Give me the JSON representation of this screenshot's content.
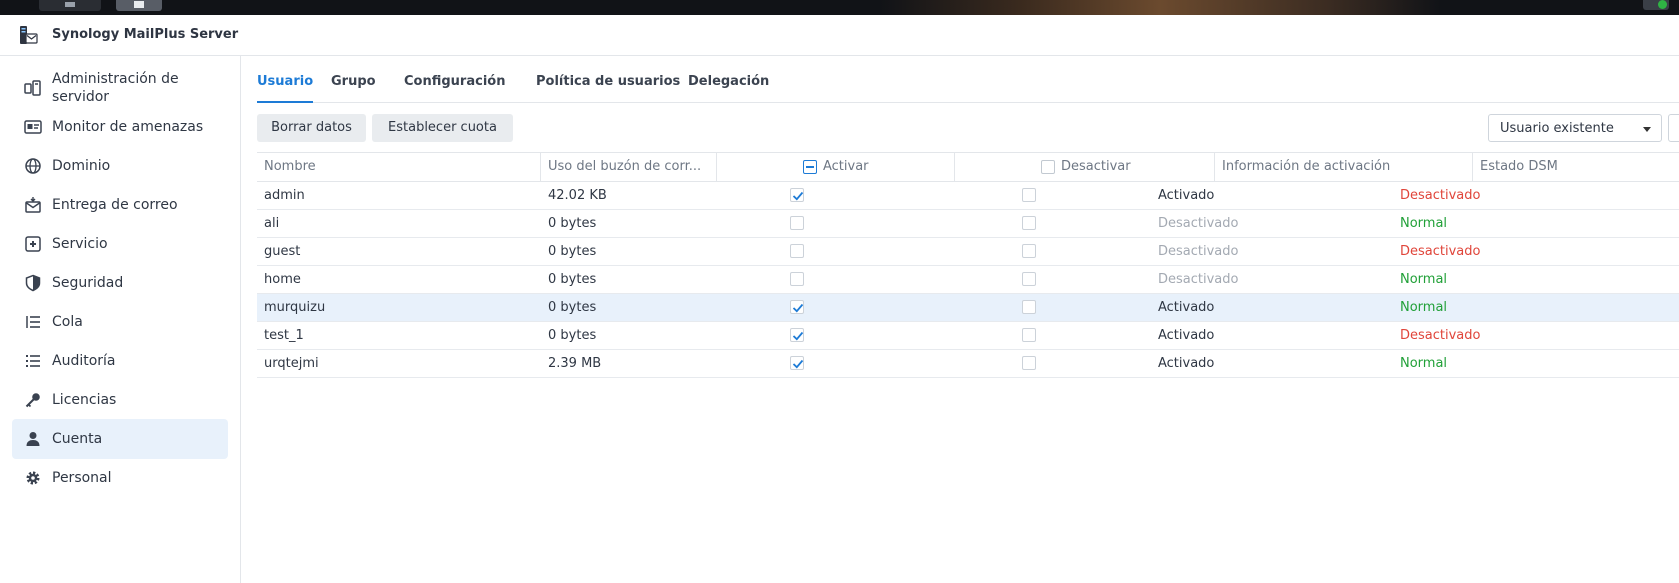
{
  "app": {
    "title": "Synology MailPlus Server"
  },
  "sidebar": {
    "items": [
      {
        "label": "Administración de servidor",
        "icon": "server-admin-icon"
      },
      {
        "label": "Monitor de amenazas",
        "icon": "threat-monitor-icon"
      },
      {
        "label": "Dominio",
        "icon": "globe-icon"
      },
      {
        "label": "Entrega de correo",
        "icon": "mail-delivery-icon"
      },
      {
        "label": "Servicio",
        "icon": "service-icon"
      },
      {
        "label": "Seguridad",
        "icon": "shield-icon"
      },
      {
        "label": "Cola",
        "icon": "queue-icon"
      },
      {
        "label": "Auditoría",
        "icon": "list-icon"
      },
      {
        "label": "Licencias",
        "icon": "key-icon"
      },
      {
        "label": "Cuenta",
        "icon": "user-icon",
        "active": true
      },
      {
        "label": "Personal",
        "icon": "gear-icon"
      }
    ]
  },
  "tabs": [
    {
      "label": "Usuario",
      "active": true
    },
    {
      "label": "Grupo"
    },
    {
      "label": "Configuración"
    },
    {
      "label": "Política de usuarios"
    },
    {
      "label": "Delegación"
    }
  ],
  "toolbar": {
    "clear_label": "Borrar datos",
    "quota_label": "Establecer cuota",
    "filter_value": "Usuario existente"
  },
  "table": {
    "headers": {
      "name": "Nombre",
      "usage": "Uso del buzón de corr...",
      "activate": "Activar",
      "deactivate": "Desactivar",
      "activation_info": "Información de activación",
      "dsm_status": "Estado DSM"
    },
    "rows": [
      {
        "name": "admin",
        "usage": "42.02 KB",
        "activate": true,
        "deactivate": false,
        "activation_info": "Activado",
        "dsm_status": "Desactivado"
      },
      {
        "name": "ali",
        "usage": "0 bytes",
        "activate": false,
        "deactivate": false,
        "activation_info": "Desactivado",
        "dsm_status": "Normal"
      },
      {
        "name": "guest",
        "usage": "0 bytes",
        "activate": false,
        "deactivate": false,
        "activation_info": "Desactivado",
        "dsm_status": "Desactivado"
      },
      {
        "name": "home",
        "usage": "0 bytes",
        "activate": false,
        "deactivate": false,
        "activation_info": "Desactivado",
        "dsm_status": "Normal"
      },
      {
        "name": "murquizu",
        "usage": "0 bytes",
        "activate": true,
        "deactivate": false,
        "activation_info": "Activado",
        "dsm_status": "Normal",
        "selected": true
      },
      {
        "name": "test_1",
        "usage": "0 bytes",
        "activate": true,
        "deactivate": false,
        "activation_info": "Activado",
        "dsm_status": "Desactivado"
      },
      {
        "name": "urqtejmi",
        "usage": "2.39 MB",
        "activate": true,
        "deactivate": false,
        "activation_info": "Activado",
        "dsm_status": "Normal"
      }
    ]
  },
  "colors": {
    "accent": "#1d7bd6",
    "danger": "#e0453a",
    "ok": "#21a038",
    "muted": "#a3a9b2"
  }
}
